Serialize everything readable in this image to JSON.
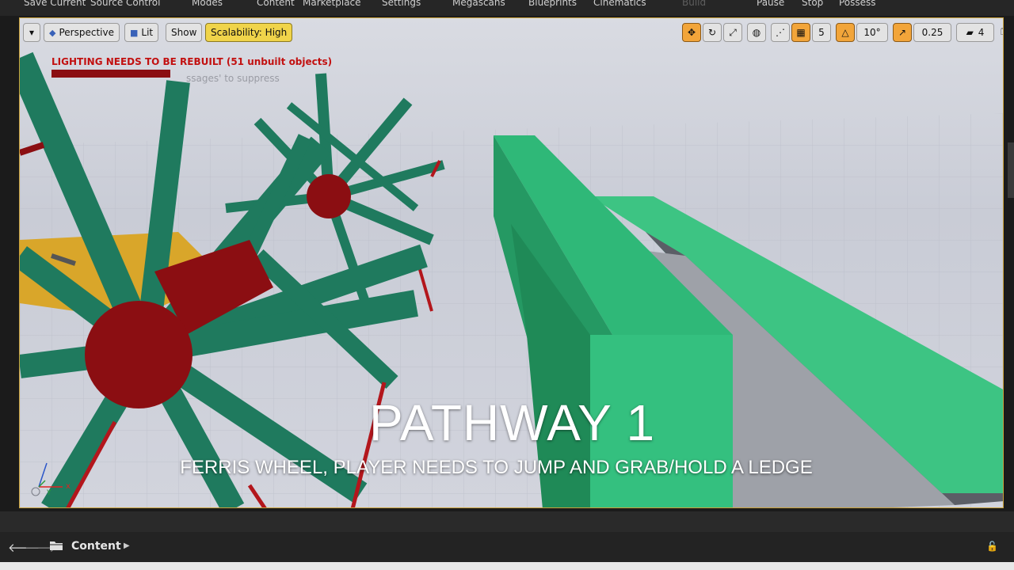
{
  "toolbar": {
    "items": [
      "Save Current",
      "Source Control",
      "Modes",
      "Content",
      "Marketplace",
      "Settings",
      "Megascans",
      "Blueprints",
      "Cinematics",
      "Build",
      "Pause",
      "Stop",
      "Possess"
    ]
  },
  "viewport": {
    "menu_label": "▾",
    "perspective": "Perspective",
    "lit": "Lit",
    "show": "Show",
    "scalability": "Scalability: High",
    "grid_snap": "5",
    "rotation_snap": "10°",
    "scale_snap": "0.25",
    "camera_speed": "4",
    "warning": "LIGHTING NEEDS TO BE REBUILT (51 unbuilt objects)",
    "suppress": "ssages' to suppress",
    "title": "PATHWAY 1",
    "subtitle": "FERRIS WHEEL, PLAYER NEEDS TO JUMP AND GRAB/HOLD A LEDGE",
    "axis_x": "x",
    "axis_y": "Y"
  },
  "content_browser": {
    "path_label": "Content"
  },
  "colors": {
    "wheel_green": "#1f7a5e",
    "ledge_green": "#3dc483",
    "hub_red": "#8b0e12",
    "platform_yellow": "#d9a62a",
    "accent_yellow": "#f0d44a",
    "accent_orange": "#f2a53a"
  }
}
